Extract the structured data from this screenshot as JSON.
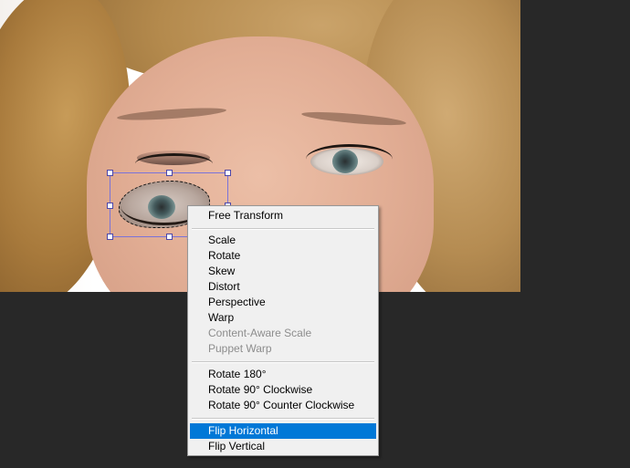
{
  "menu": {
    "items": [
      {
        "label": "Free Transform",
        "enabled": true
      },
      {
        "label": "Scale",
        "enabled": true
      },
      {
        "label": "Rotate",
        "enabled": true
      },
      {
        "label": "Skew",
        "enabled": true
      },
      {
        "label": "Distort",
        "enabled": true
      },
      {
        "label": "Perspective",
        "enabled": true
      },
      {
        "label": "Warp",
        "enabled": true
      },
      {
        "label": "Content-Aware Scale",
        "enabled": false
      },
      {
        "label": "Puppet Warp",
        "enabled": false
      },
      {
        "label": "Rotate 180°",
        "enabled": true
      },
      {
        "label": "Rotate 90° Clockwise",
        "enabled": true
      },
      {
        "label": "Rotate 90° Counter Clockwise",
        "enabled": true
      },
      {
        "label": "Flip Horizontal",
        "enabled": true,
        "highlighted": true
      },
      {
        "label": "Flip Vertical",
        "enabled": true
      }
    ]
  },
  "colors": {
    "workspace_bg": "#282828",
    "menu_bg": "#f0f0f0",
    "highlight": "#0078d7",
    "bounding_box": "#7a73d9"
  }
}
